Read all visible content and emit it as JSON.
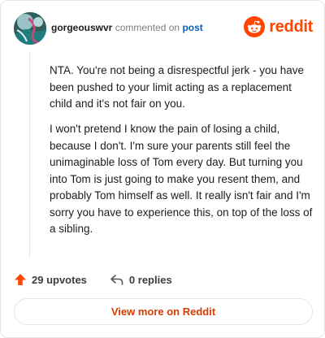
{
  "header": {
    "username": "gorgeouswvr",
    "action_text": "commented on",
    "post_link": "post",
    "brand": "reddit"
  },
  "comment": {
    "paragraphs": [
      "NTA. You're not being a disrespectful jerk - you have been pushed to your limit acting as a replacement child and it's not fair on you.",
      "I won't pretend I know the pain of losing a child, because I don't. I'm sure your parents still feel the unimaginable loss of Tom every day. But turning you into Tom is just going to make you resent them, and probably Tom himself as well. It really isn't fair and I'm sorry you have to experience this, on top of the loss of a sibling."
    ]
  },
  "footer": {
    "upvotes": "29 upvotes",
    "replies": "0 replies"
  },
  "view_more_label": "View more on Reddit",
  "colors": {
    "brand": "#ff4500",
    "link": "#0a5fb4",
    "upvote": "#ff4500",
    "view_more": "#d93a00"
  },
  "icons": {
    "avatar": "user-avatar",
    "brand": "reddit-snoo-icon",
    "upvote": "upvote-arrow-icon",
    "reply": "reply-arrow-icon"
  }
}
